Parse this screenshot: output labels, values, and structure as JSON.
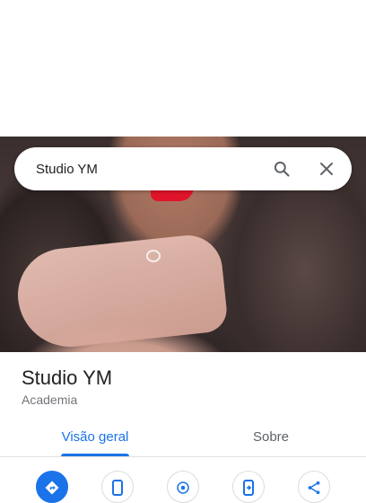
{
  "search": {
    "query": "Studio YM"
  },
  "place": {
    "name": "Studio YM",
    "category": "Academia"
  },
  "tabs": [
    {
      "label": "Visão geral",
      "active": true
    },
    {
      "label": "Sobre",
      "active": false
    }
  ],
  "actions": [
    {
      "icon": "directions-icon",
      "primary": true
    },
    {
      "icon": "phone-icon"
    },
    {
      "icon": "nearby-icon"
    },
    {
      "icon": "send-to-phone-icon"
    },
    {
      "icon": "share-icon"
    }
  ],
  "colors": {
    "accent": "#1a73e8",
    "text": "#202124",
    "secondary": "#70757a"
  }
}
